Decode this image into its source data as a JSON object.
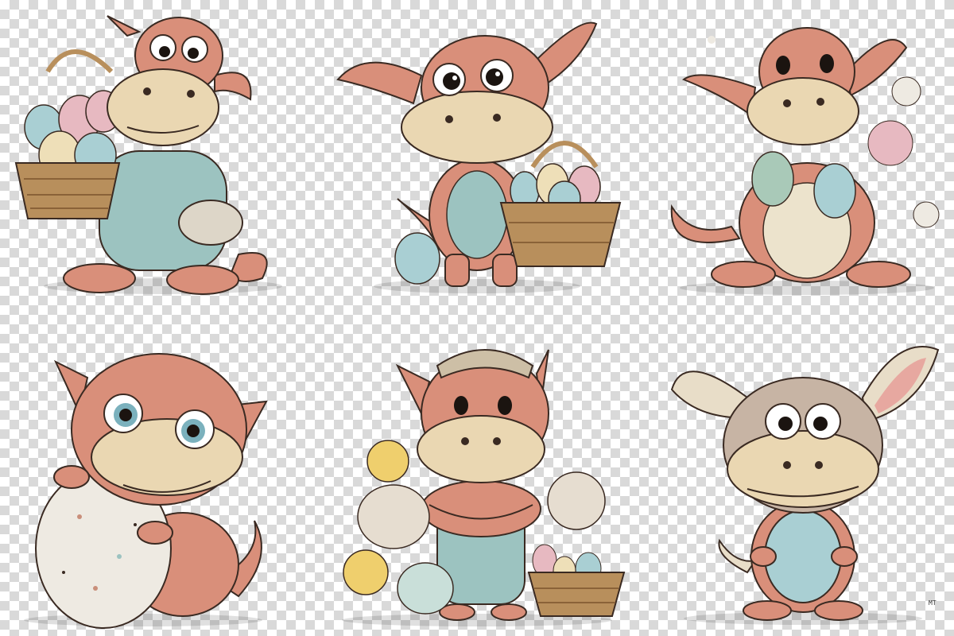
{
  "image": {
    "background": "transparency-checkerboard",
    "colors": {
      "dragon_skin": "#d98f7a",
      "muzzle": "#ead7b2",
      "overalls": "#9cc3c0",
      "basket": "#b88f5c",
      "egg_blue": "#a9cfd3",
      "egg_pink": "#e7b9c1",
      "egg_cream": "#eedfb8",
      "chick": "#efcf6d",
      "outline": "#3a2a22"
    },
    "signature": "MT",
    "illustrations": [
      {
        "name": "dragon-with-egg-basket-overalls"
      },
      {
        "name": "winged-dragon-with-basket"
      },
      {
        "name": "sitting-dragon-holding-eggs"
      },
      {
        "name": "baby-dragon-hugging-speckled-egg"
      },
      {
        "name": "dragon-in-beanie-with-chicks"
      },
      {
        "name": "dragon-with-bunny-ears-holding-egg"
      }
    ]
  }
}
